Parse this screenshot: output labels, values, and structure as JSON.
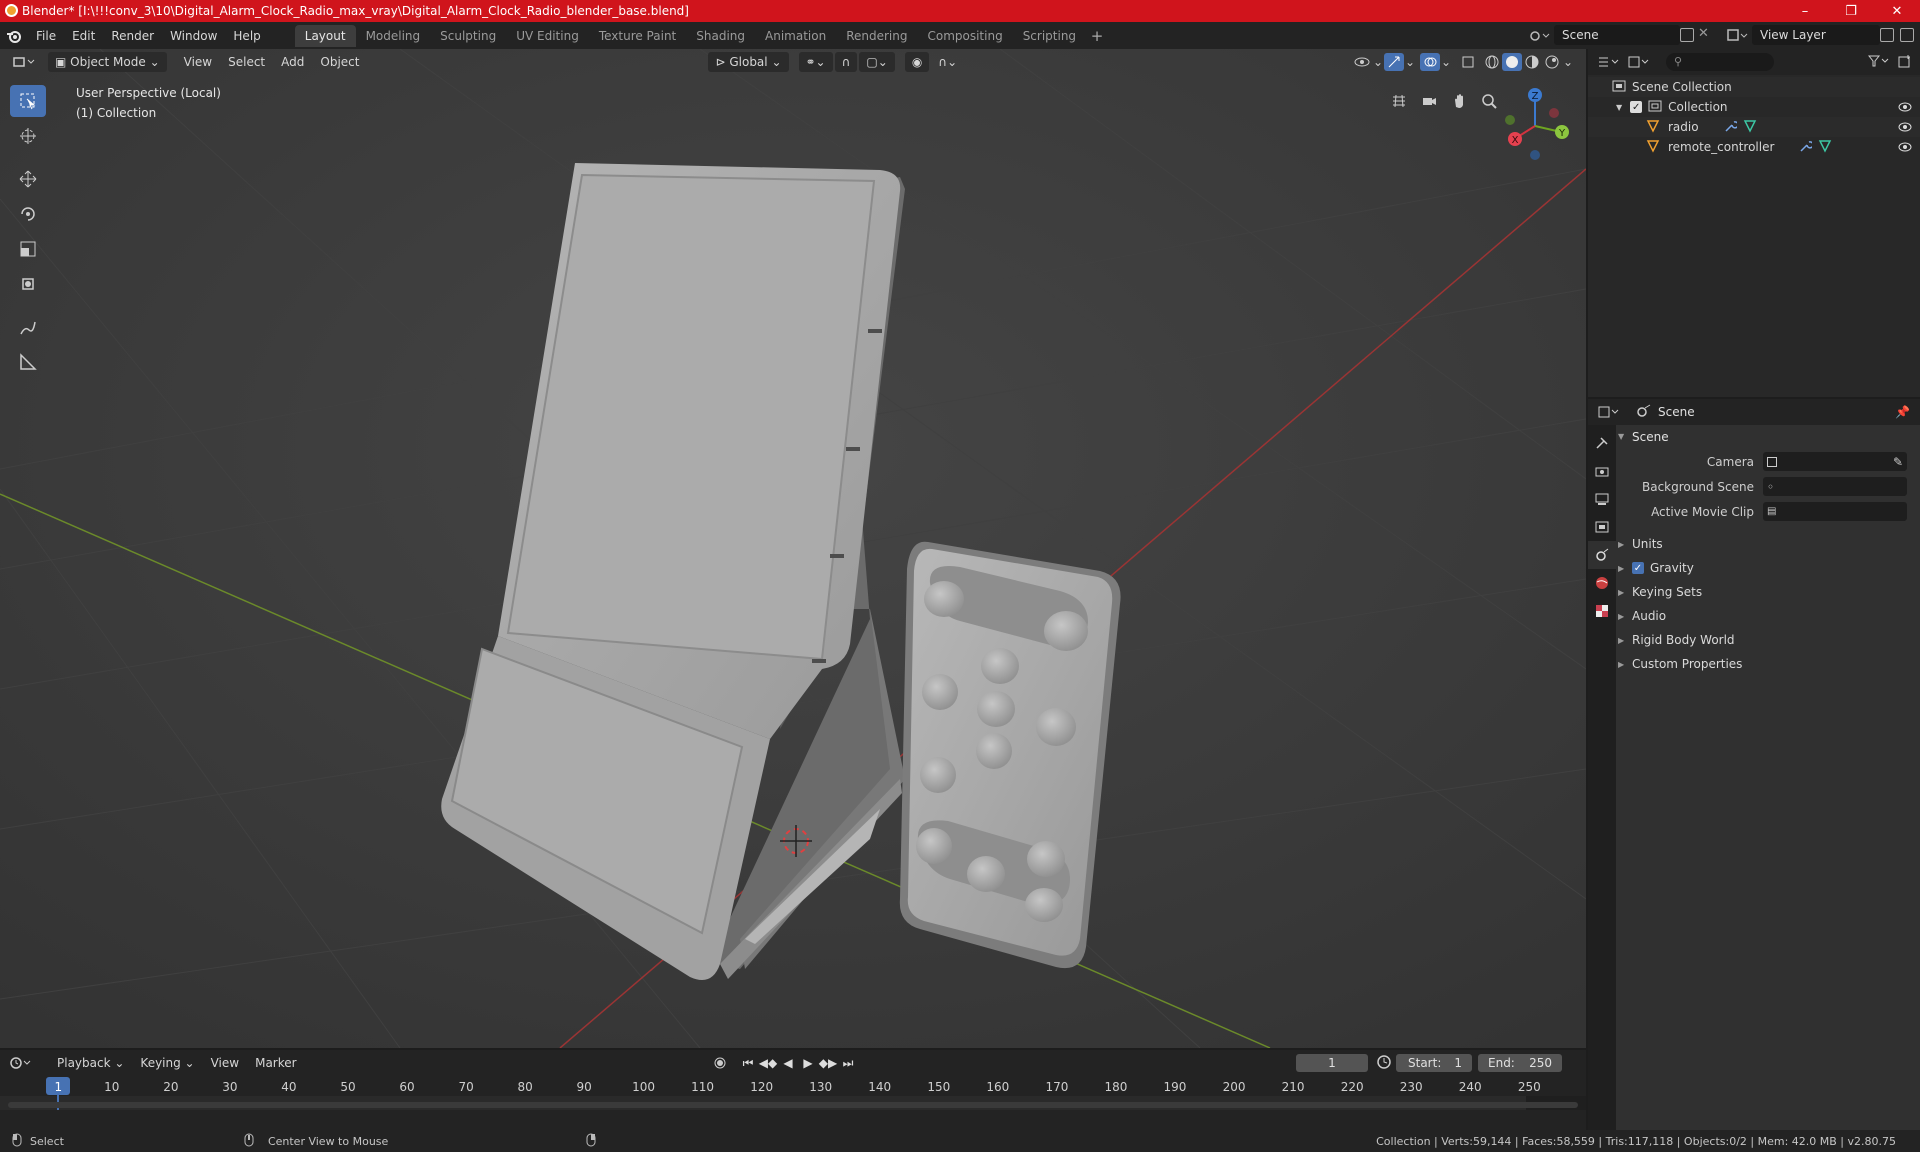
{
  "window": {
    "title": "Blender* [I:\\!!!conv_3\\10\\Digital_Alarm_Clock_Radio_max_vray\\Digital_Alarm_Clock_Radio_blender_base.blend]",
    "accent": "#d0141c"
  },
  "menu": [
    "File",
    "Edit",
    "Render",
    "Window",
    "Help"
  ],
  "workspaces": [
    "Layout",
    "Modeling",
    "Sculpting",
    "UV Editing",
    "Texture Paint",
    "Shading",
    "Animation",
    "Rendering",
    "Compositing",
    "Scripting"
  ],
  "active_workspace": "Layout",
  "scene_name": "Scene",
  "view_layer": "View Layer",
  "viewport": {
    "mode": "Object Mode",
    "menus": [
      "View",
      "Select",
      "Add",
      "Object"
    ],
    "orientation": "Global",
    "info_line1": "User Perspective (Local)",
    "info_line2": "(1) Collection",
    "gizmo": {
      "x": "X",
      "y": "Y",
      "z": "Z"
    }
  },
  "outliner": {
    "search_placeholder": "",
    "root": "Scene Collection",
    "collection": "Collection",
    "objects": [
      "radio",
      "remote_controller"
    ]
  },
  "properties": {
    "header": "Scene",
    "panel_title": "Scene",
    "fields": [
      {
        "label": "Camera",
        "value": ""
      },
      {
        "label": "Background Scene",
        "value": ""
      },
      {
        "label": "Active Movie Clip",
        "value": ""
      }
    ],
    "subpanels": [
      "Units",
      "Gravity",
      "Keying Sets",
      "Audio",
      "Rigid Body World",
      "Custom Properties"
    ]
  },
  "timeline": {
    "menus": [
      "Playback",
      "Keying",
      "View",
      "Marker"
    ],
    "current_frame": "1",
    "start_label": "Start:",
    "start": "1",
    "end_label": "End:",
    "end": "250",
    "ticks": [
      "1",
      "10",
      "20",
      "30",
      "40",
      "50",
      "60",
      "70",
      "80",
      "90",
      "100",
      "110",
      "120",
      "130",
      "140",
      "150",
      "160",
      "170",
      "180",
      "190",
      "200",
      "210",
      "220",
      "230",
      "240",
      "250"
    ]
  },
  "status": {
    "left1": "Select",
    "left2": "Center View to Mouse",
    "right": "Collection | Verts:59,144 | Faces:58,559 | Tris:117,118 | Objects:0/2 | Mem: 42.0 MB | v2.80.75"
  }
}
